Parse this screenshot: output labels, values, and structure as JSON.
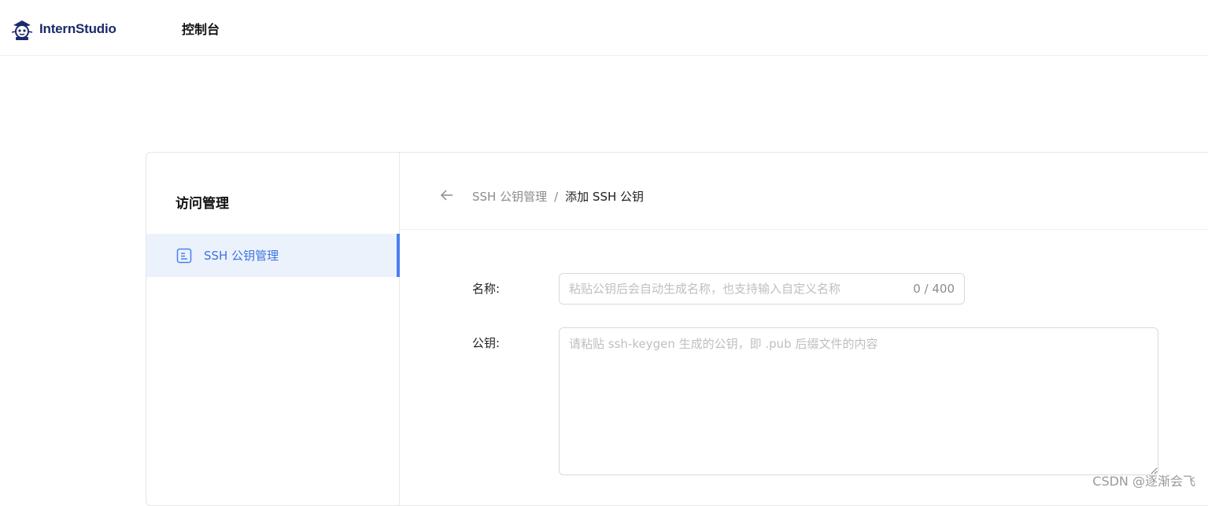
{
  "header": {
    "logo_text": "InternStudio",
    "nav_console": "控制台"
  },
  "sidebar": {
    "title": "访问管理",
    "items": [
      {
        "label": "SSH 公钥管理",
        "icon": "document-list-icon",
        "active": true
      }
    ]
  },
  "breadcrumb": {
    "parent": "SSH 公钥管理",
    "separator": "/",
    "current": "添加 SSH 公钥"
  },
  "form": {
    "name_label": "名称:",
    "name_placeholder": "粘贴公钥后会自动生成名称，也支持输入自定义名称",
    "name_value": "",
    "name_counter": "0 / 400",
    "key_label": "公钥:",
    "key_placeholder": "请粘贴 ssh-keygen 生成的公钥，即 .pub 后缀文件的内容",
    "key_value": ""
  },
  "watermark": "CSDN @逐渐会飞",
  "colors": {
    "accent": "#4a7ff0",
    "active_bg": "#ebf2fc",
    "logo": "#1b2a6b"
  }
}
